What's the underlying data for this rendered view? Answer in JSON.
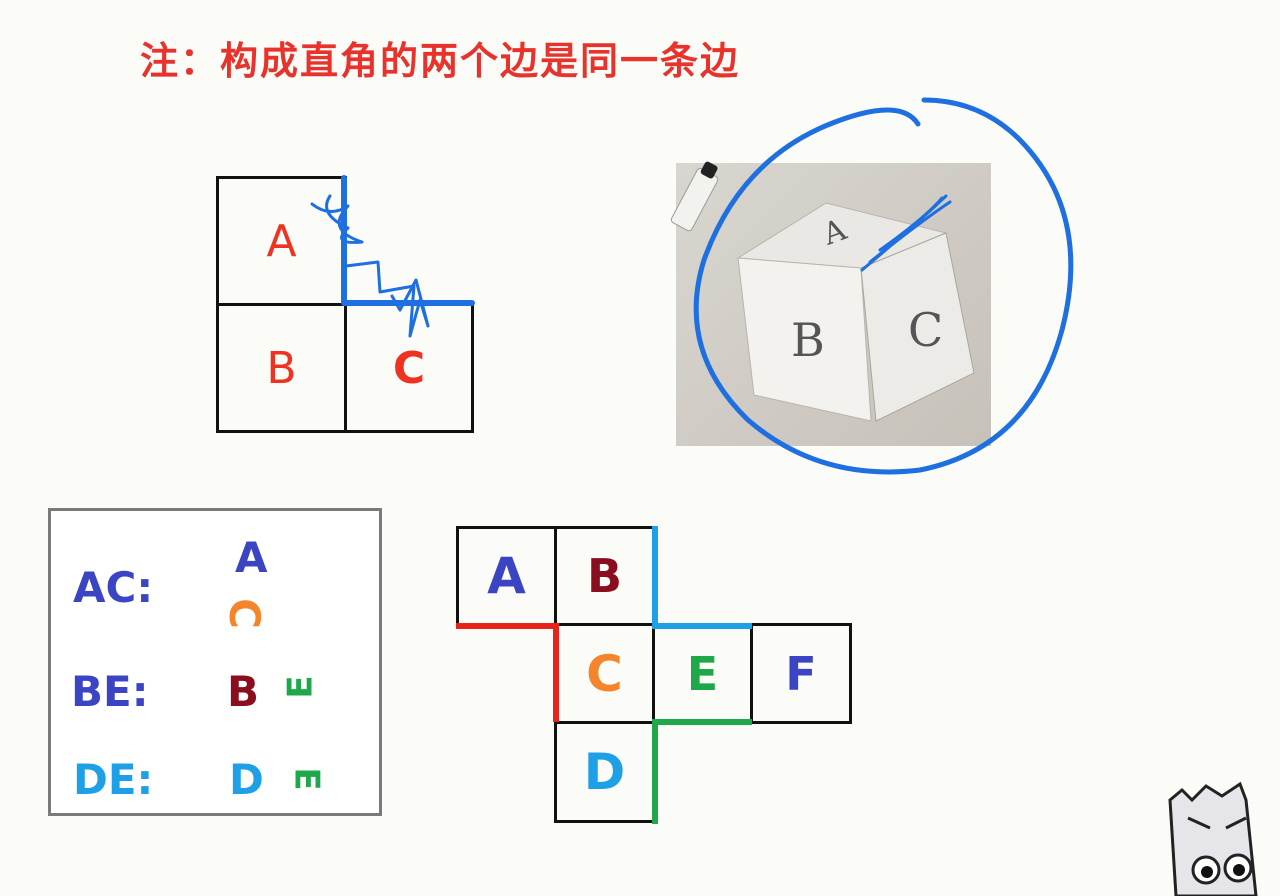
{
  "note": "注：构成直角的两个边是同一条边",
  "left_net": {
    "a": "A",
    "b": "B",
    "c": "C"
  },
  "photo": {
    "top": "A",
    "left": "B",
    "right": "C"
  },
  "legend": {
    "rows": [
      {
        "key": "AC:",
        "first": "A",
        "second": "C"
      },
      {
        "key": "BE:",
        "first": "B",
        "second": "E"
      },
      {
        "key": "DE:",
        "first": "D",
        "second": "E"
      }
    ]
  },
  "right_net": {
    "a": "A",
    "b": "B",
    "c": "C",
    "e": "E",
    "f": "F",
    "d": "D"
  },
  "colors": {
    "note_red": "#e8332c",
    "ink_blue": "#1e6fe0",
    "edge_red": "#e8241a",
    "edge_sky": "#1ea0e6",
    "edge_green": "#1fa84a"
  }
}
